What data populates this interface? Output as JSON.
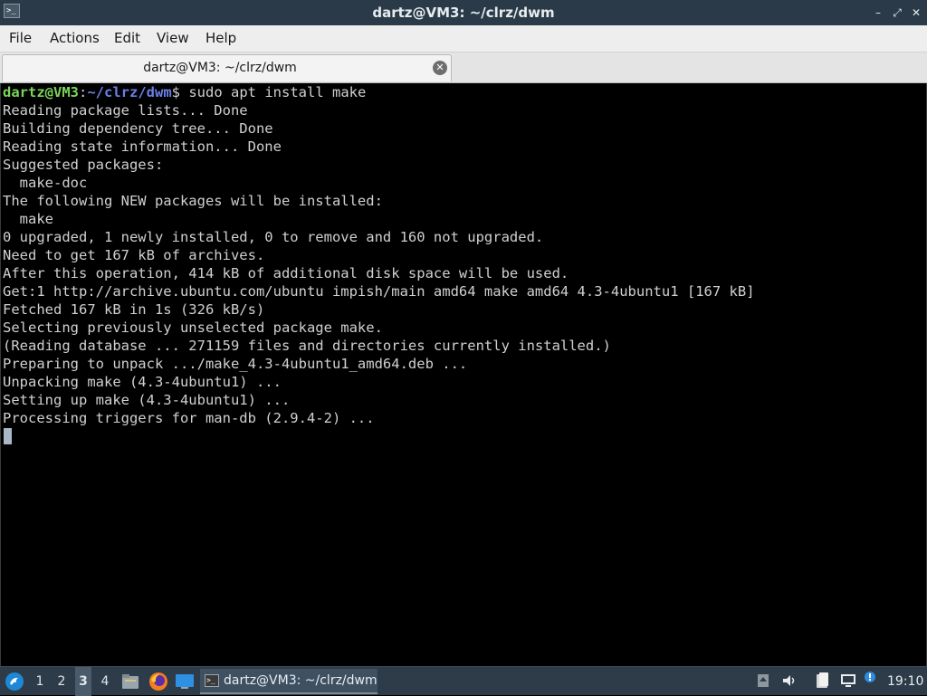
{
  "window": {
    "title": "dartz@VM3: ~/clrz/dwm",
    "app_icon_glyph": ">_",
    "minimize_glyph": "–",
    "restore_glyph": "⤢",
    "close_glyph": "✕"
  },
  "menubar": {
    "items": [
      {
        "label": "File"
      },
      {
        "label": "Actions"
      },
      {
        "label": "Edit"
      },
      {
        "label": "View"
      },
      {
        "label": "Help"
      }
    ]
  },
  "tabs": [
    {
      "label": "dartz@VM3: ~/clrz/dwm",
      "close_glyph": "✕"
    }
  ],
  "terminal": {
    "prompt": {
      "user_host": "dartz@VM3",
      "colon": ":",
      "path": "~/clrz/dwm",
      "dollar": "$",
      "command": " sudo apt install make"
    },
    "output": [
      "Reading package lists... Done",
      "Building dependency tree... Done",
      "Reading state information... Done",
      "Suggested packages:",
      "  make-doc",
      "The following NEW packages will be installed:",
      "  make",
      "0 upgraded, 1 newly installed, 0 to remove and 160 not upgraded.",
      "Need to get 167 kB of archives.",
      "After this operation, 414 kB of additional disk space will be used.",
      "Get:1 http://archive.ubuntu.com/ubuntu impish/main amd64 make amd64 4.3-4ubuntu1 [167 kB]",
      "Fetched 167 kB in 1s (326 kB/s)",
      "Selecting previously unselected package make.",
      "(Reading database ... 271159 files and directories currently installed.)",
      "Preparing to unpack .../make_4.3-4ubuntu1_amd64.deb ...",
      "Unpacking make (4.3-4ubuntu1) ...",
      "Setting up make (4.3-4ubuntu1) ...",
      "Processing triggers for man-db (2.9.4-2) ..."
    ]
  },
  "taskbar": {
    "workspaces": [
      "1",
      "2",
      "3",
      "4"
    ],
    "active_workspace": "3",
    "launchers": [
      "file-manager-icon",
      "firefox-icon",
      "desktop-icon"
    ],
    "task": {
      "label": "dartz@VM3: ~/clrz/dwm",
      "icon_glyph": ">_"
    },
    "tray": [
      "disk-icon",
      "volume-icon",
      "clipboard-icon",
      "network-icon"
    ],
    "clock": "19:10"
  },
  "colors": {
    "titlebar": "#2b3a48",
    "terminal_bg": "#000000",
    "terminal_fg": "#d0d0d0",
    "prompt_user": "#7bd45a",
    "prompt_path": "#6b7fe8",
    "taskbar": "#2e3c49"
  }
}
